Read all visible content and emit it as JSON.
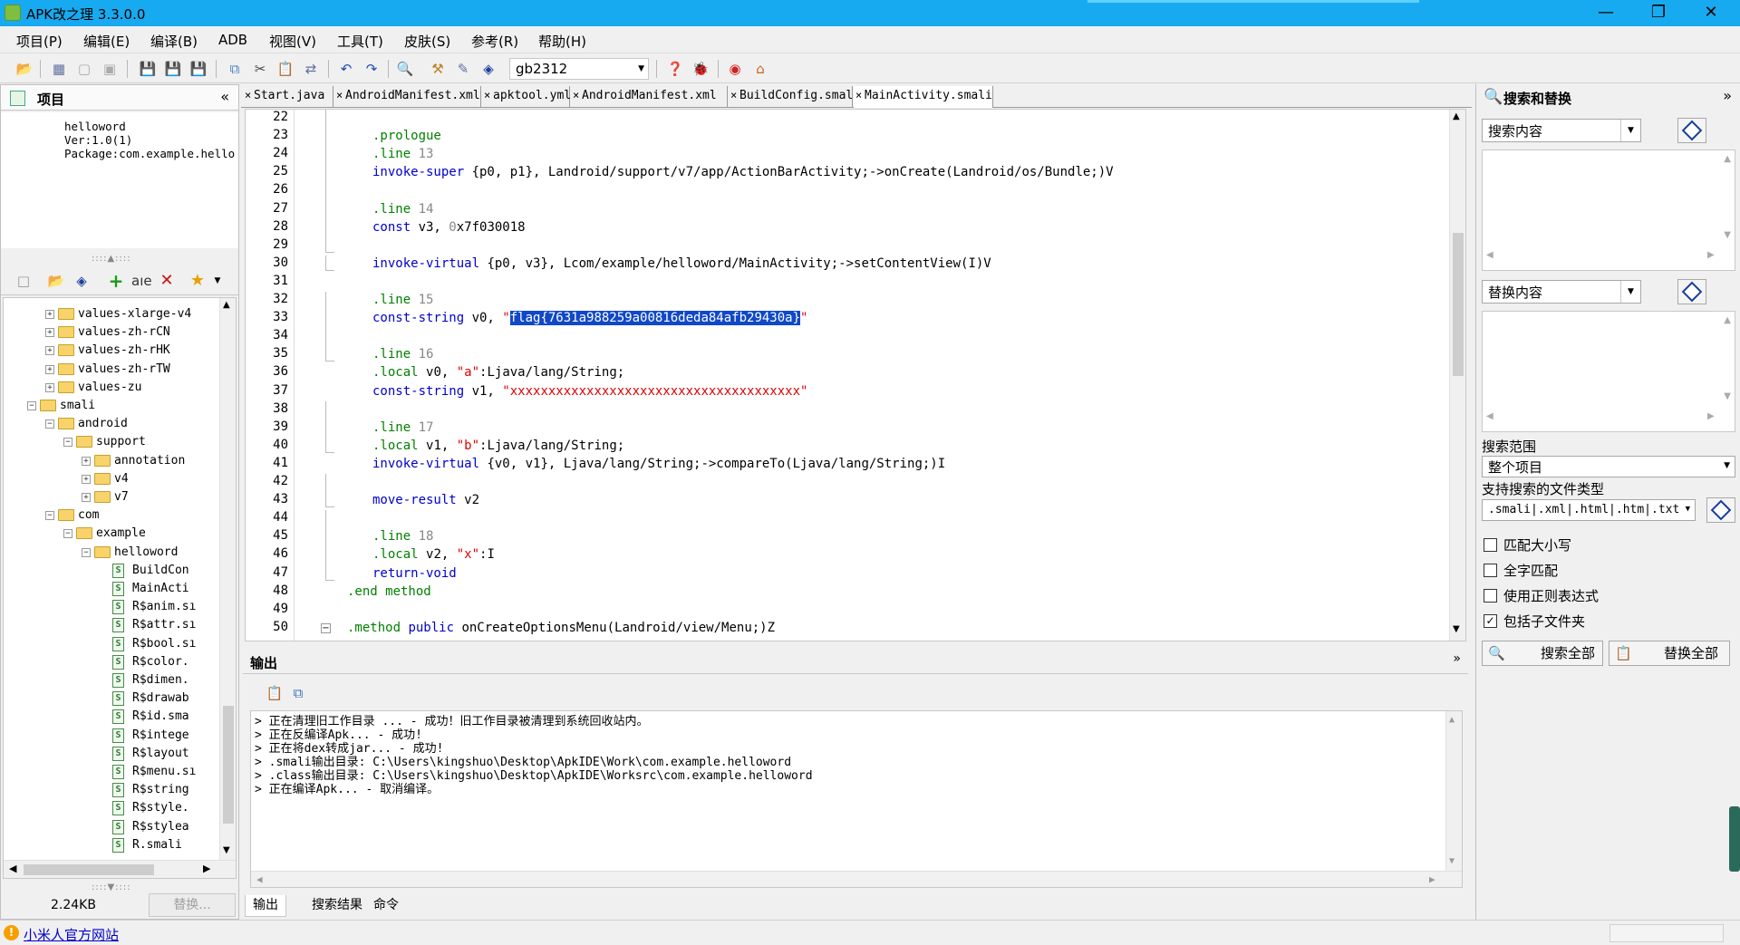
{
  "app": {
    "title": "APK改之理 3.3.0.0"
  },
  "menu": [
    "项目(P)",
    "编辑(E)",
    "编译(B)",
    "ADB",
    "视图(V)",
    "工具(T)",
    "皮肤(S)",
    "参考(R)",
    "帮助(H)"
  ],
  "toolbar": {
    "encoding": "gb2312"
  },
  "project_panel": {
    "title": "项目",
    "info": [
      "helloword",
      "Ver:1.0(1)",
      "Package:com.example.hello"
    ],
    "tree": [
      {
        "label": "values-xlarge-v4",
        "type": "folder",
        "depth": 2,
        "expander": "+"
      },
      {
        "label": "values-zh-rCN",
        "type": "folder",
        "depth": 2,
        "expander": "+"
      },
      {
        "label": "values-zh-rHK",
        "type": "folder",
        "depth": 2,
        "expander": "+"
      },
      {
        "label": "values-zh-rTW",
        "type": "folder",
        "depth": 2,
        "expander": "+"
      },
      {
        "label": "values-zu",
        "type": "folder",
        "depth": 2,
        "expander": "+"
      },
      {
        "label": "smali",
        "type": "folder",
        "depth": 1,
        "expander": "−"
      },
      {
        "label": "android",
        "type": "folder",
        "depth": 2,
        "expander": "−"
      },
      {
        "label": "support",
        "type": "folder",
        "depth": 3,
        "expander": "−"
      },
      {
        "label": "annotation",
        "type": "folder",
        "depth": 4,
        "expander": "+"
      },
      {
        "label": "v4",
        "type": "folder",
        "depth": 4,
        "expander": "+"
      },
      {
        "label": "v7",
        "type": "folder",
        "depth": 4,
        "expander": "+"
      },
      {
        "label": "com",
        "type": "folder",
        "depth": 2,
        "expander": "−"
      },
      {
        "label": "example",
        "type": "folder",
        "depth": 3,
        "expander": "−"
      },
      {
        "label": "helloword",
        "type": "folder",
        "depth": 4,
        "expander": "−"
      },
      {
        "label": "BuildCon",
        "type": "smali",
        "depth": 5
      },
      {
        "label": "MainActi",
        "type": "smali",
        "depth": 5
      },
      {
        "label": "R$anim.sı",
        "type": "smali",
        "depth": 5
      },
      {
        "label": "R$attr.sı",
        "type": "smali",
        "depth": 5
      },
      {
        "label": "R$bool.sı",
        "type": "smali",
        "depth": 5
      },
      {
        "label": "R$color.",
        "type": "smali",
        "depth": 5
      },
      {
        "label": "R$dimen.",
        "type": "smali",
        "depth": 5
      },
      {
        "label": "R$drawab",
        "type": "smali",
        "depth": 5
      },
      {
        "label": "R$id.sma",
        "type": "smali",
        "depth": 5
      },
      {
        "label": "R$intege",
        "type": "smali",
        "depth": 5
      },
      {
        "label": "R$layout",
        "type": "smali",
        "depth": 5
      },
      {
        "label": "R$menu.sı",
        "type": "smali",
        "depth": 5
      },
      {
        "label": "R$string",
        "type": "smali",
        "depth": 5
      },
      {
        "label": "R$style.",
        "type": "smali",
        "depth": 5
      },
      {
        "label": "R$stylea",
        "type": "smali",
        "depth": 5
      },
      {
        "label": "R.smali",
        "type": "smali",
        "depth": 5
      }
    ],
    "size": "2.24KB",
    "replace_button": "替换..."
  },
  "tabs": [
    {
      "label": "Start.java"
    },
    {
      "label": "AndroidManifest.xml"
    },
    {
      "label": "apktool.yml"
    },
    {
      "label": "AndroidManifest.xml"
    },
    {
      "label": "BuildConfig.smali"
    },
    {
      "label": "MainActivity.smali",
      "active": true
    }
  ],
  "code": {
    "lines": [
      {
        "n": "22",
        "t": []
      },
      {
        "n": "23",
        "t": [
          [
            ".prologue",
            "d"
          ]
        ]
      },
      {
        "n": "24",
        "t": [
          [
            ".line ",
            "d"
          ],
          [
            "13",
            "n"
          ]
        ]
      },
      {
        "n": "25",
        "t": [
          [
            "invoke-super ",
            "kw"
          ],
          [
            "{p0, p1}, Landroid/support/v7/app/ActionBarActivity;->onCreate(Landroid/os/Bundle;)V",
            "o"
          ]
        ]
      },
      {
        "n": "26",
        "t": []
      },
      {
        "n": "27",
        "t": [
          [
            ".line ",
            "d"
          ],
          [
            "14",
            "n"
          ]
        ]
      },
      {
        "n": "28",
        "t": [
          [
            "const ",
            "kw"
          ],
          [
            "v3, ",
            "o"
          ],
          [
            "0",
            "n"
          ],
          [
            "x7f030018",
            "o"
          ]
        ]
      },
      {
        "n": "29",
        "t": []
      },
      {
        "n": "30",
        "t": [
          [
            "invoke-virtual ",
            "kw"
          ],
          [
            "{p0, v3}, Lcom/example/helloword/MainActivity;->setContentView(I)V",
            "o"
          ]
        ]
      },
      {
        "n": "31",
        "t": []
      },
      {
        "n": "32",
        "t": [
          [
            ".line ",
            "d"
          ],
          [
            "15",
            "n"
          ]
        ]
      },
      {
        "n": "33",
        "t": [
          [
            "const-string ",
            "kw"
          ],
          [
            "v0, ",
            "o"
          ],
          [
            "\"",
            "s"
          ],
          [
            "flag{7631a988259a00816deda84afb29430a}",
            "sel"
          ],
          [
            "\"",
            "s"
          ]
        ]
      },
      {
        "n": "34",
        "t": []
      },
      {
        "n": "35",
        "t": [
          [
            ".line ",
            "d"
          ],
          [
            "16",
            "n"
          ]
        ]
      },
      {
        "n": "36",
        "t": [
          [
            ".local ",
            "d"
          ],
          [
            "v0, ",
            "o"
          ],
          [
            "\"a\"",
            "s"
          ],
          [
            ":Ljava/lang/String;",
            "o"
          ]
        ]
      },
      {
        "n": "37",
        "t": [
          [
            "const-string ",
            "kw"
          ],
          [
            "v1, ",
            "o"
          ],
          [
            "\"xxxxxxxxxxxxxxxxxxxxxxxxxxxxxxxxxxxxxx\"",
            "s"
          ]
        ]
      },
      {
        "n": "38",
        "t": []
      },
      {
        "n": "39",
        "t": [
          [
            ".line ",
            "d"
          ],
          [
            "17",
            "n"
          ]
        ]
      },
      {
        "n": "40",
        "t": [
          [
            ".local ",
            "d"
          ],
          [
            "v1, ",
            "o"
          ],
          [
            "\"b\"",
            "s"
          ],
          [
            ":Ljava/lang/String;",
            "o"
          ]
        ]
      },
      {
        "n": "41",
        "t": [
          [
            "invoke-virtual ",
            "kw"
          ],
          [
            "{v0, v1}, Ljava/lang/String;->compareTo(Ljava/lang/String;)I",
            "o"
          ]
        ]
      },
      {
        "n": "42",
        "t": []
      },
      {
        "n": "43",
        "t": [
          [
            "move-result ",
            "kw"
          ],
          [
            "v2",
            "o"
          ]
        ]
      },
      {
        "n": "44",
        "t": []
      },
      {
        "n": "45",
        "t": [
          [
            ".line ",
            "d"
          ],
          [
            "18",
            "n"
          ]
        ]
      },
      {
        "n": "46",
        "t": [
          [
            ".local ",
            "d"
          ],
          [
            "v2, ",
            "o"
          ],
          [
            "\"x\"",
            "s"
          ],
          [
            ":I",
            "o"
          ]
        ]
      },
      {
        "n": "47",
        "t": [
          [
            "return-void",
            "kw"
          ]
        ]
      },
      {
        "n": "48",
        "t": [
          [
            ".end method",
            "d"
          ]
        ]
      },
      {
        "n": "49",
        "t": []
      },
      {
        "n": "50",
        "t": [
          [
            ".method ",
            "d"
          ],
          [
            "public ",
            "kw"
          ],
          [
            "onCreateOptionsMenu(Landroid/view/Menu;)Z",
            "o"
          ]
        ]
      }
    ]
  },
  "output": {
    "title": "输出",
    "lines": [
      "> 正在清理旧工作目录 ... - 成功！旧工作目录被清理到系统回收站内。",
      "> 正在反编译Apk... - 成功!",
      "> 正在将dex转成jar... - 成功!",
      "> .smali输出目录: C:\\Users\\kingshuo\\Desktop\\ApkIDE\\Work\\com.example.helloword",
      "> .class输出目录: C:\\Users\\kingshuo\\Desktop\\ApkIDE\\Worksrc\\com.example.helloword",
      "> 正在编译Apk... - 取消编译。"
    ],
    "tabs": [
      "输出",
      "搜索结果",
      "命令"
    ]
  },
  "search_panel": {
    "title": "搜索和替换",
    "search_label": "搜索内容",
    "replace_label": "替换内容",
    "scope_label": "搜索范围",
    "scope_value": "整个项目",
    "filetypes_label": "支持搜索的文件类型",
    "filetypes_value": ".smali|.xml|.html|.htm|.txt",
    "options": [
      {
        "label": "匹配大小写",
        "checked": false
      },
      {
        "label": "全字匹配",
        "checked": false
      },
      {
        "label": "使用正则表达式",
        "checked": false
      },
      {
        "label": "包括子文件夹",
        "checked": true
      }
    ],
    "search_all": "搜索全部",
    "replace_all": "替换全部"
  },
  "status": {
    "link": "小米人官方网站"
  }
}
